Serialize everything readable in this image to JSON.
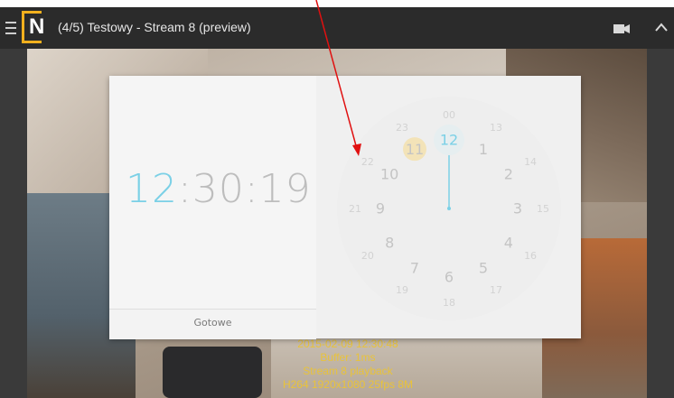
{
  "app": {
    "logo_letter": "N",
    "title": "(4/5) Testowy - Stream 8 (preview)",
    "icons": [
      "menu-icon",
      "video-camera-icon",
      "chevron-up-icon"
    ]
  },
  "video_overlay": {
    "lines": [
      "2015-02-09 12:30:48",
      "Buffer: 1ms",
      "Stream 8 playback",
      "H264 1920x1080 25fps 8M"
    ]
  },
  "time_picker": {
    "hour": "12",
    "sep1": ":",
    "minute": "30",
    "sep2": ":",
    "second": "19",
    "done_label": "Gotowe",
    "outer_hours": [
      "12",
      "1",
      "2",
      "3",
      "4",
      "5",
      "6",
      "7",
      "8",
      "9",
      "10",
      "11"
    ],
    "inner_hours": [
      "00",
      "13",
      "14",
      "15",
      "16",
      "17",
      "18",
      "19",
      "20",
      "21",
      "22",
      "23"
    ],
    "selected_hour": "12",
    "highlight_hour": "11",
    "colors": {
      "accent": "#7bd0e6",
      "highlight": "#f3e3b8"
    }
  },
  "annotation": {
    "type": "arrow",
    "color": "#e01010"
  }
}
